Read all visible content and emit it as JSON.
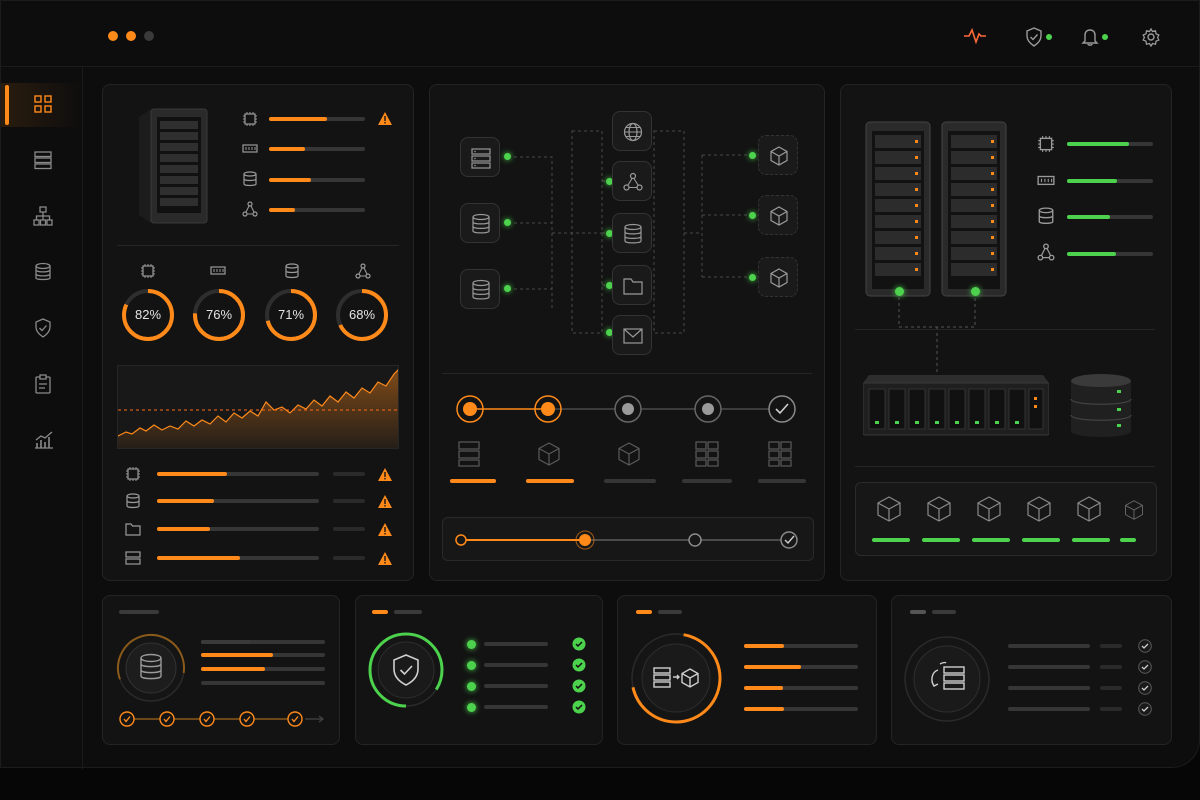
{
  "window": {
    "controls": [
      "close-dot",
      "minimize-dot",
      "maximize-dot"
    ],
    "accent": "#ff8a1a",
    "ok": "#4cd24c"
  },
  "header": {
    "icons": [
      "pulse-icon",
      "shield-check-icon",
      "bell-icon",
      "settings-icon"
    ]
  },
  "sidebar": {
    "items": [
      "dashboard",
      "servers",
      "network",
      "storage",
      "security",
      "reports",
      "analytics"
    ]
  },
  "resources": {
    "gauges": [
      {
        "name": "cpu",
        "value": "82%",
        "fraction": 0.82
      },
      {
        "name": "memory",
        "value": "76%",
        "fraction": 0.76
      },
      {
        "name": "storage",
        "value": "71%",
        "fraction": 0.71
      },
      {
        "name": "network",
        "value": "68%",
        "fraction": 0.68
      }
    ],
    "top_bar_fractions": [
      0.6,
      0.38,
      0.44,
      0.27
    ],
    "bottom_bar_fractions": [
      0.43,
      0.35,
      0.33,
      0.51
    ]
  },
  "pipeline": {
    "step_states": [
      "done",
      "done",
      "pending",
      "pending",
      "complete"
    ],
    "slider_fraction": 0.38
  },
  "cards": {
    "tasks_completed": 5,
    "security_checks": 4
  }
}
